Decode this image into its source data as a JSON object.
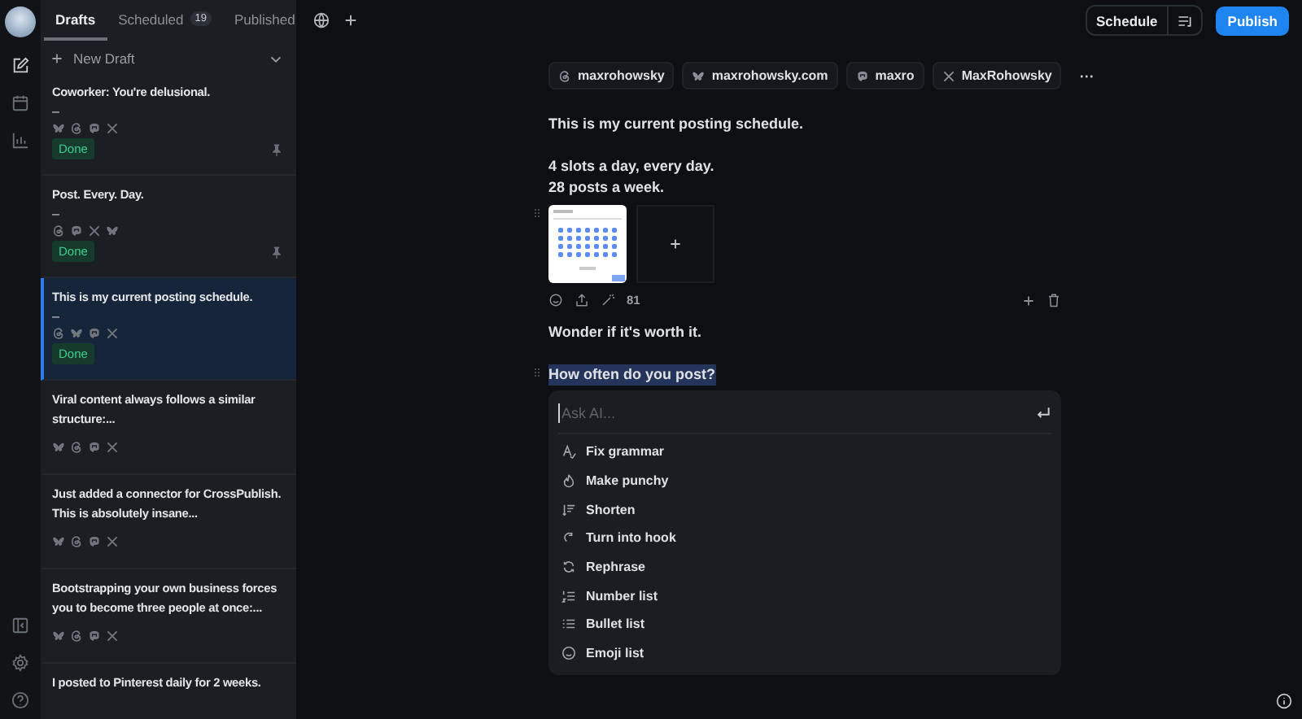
{
  "tabs": [
    {
      "label": "Drafts",
      "selected": true
    },
    {
      "label": "Scheduled",
      "selected": false,
      "count": "19"
    },
    {
      "label": "Published",
      "selected": false
    }
  ],
  "new_draft": {
    "label": "New Draft"
  },
  "drafts": [
    {
      "title": "Coworker: You're delusional.",
      "dash": "–",
      "platforms": [
        {
          "kind": "bluesky"
        },
        {
          "kind": "threads"
        },
        {
          "kind": "mastodon"
        },
        {
          "kind": "x"
        }
      ],
      "status": "Done",
      "pinned": true,
      "selected": false
    },
    {
      "title": "Post. Every. Day.",
      "dash": "–",
      "platforms": [
        {
          "kind": "threads"
        },
        {
          "kind": "mastodon"
        },
        {
          "kind": "x"
        },
        {
          "kind": "bluesky"
        }
      ],
      "status": "Done",
      "pinned": true,
      "selected": false
    },
    {
      "title": "This is my current posting schedule.",
      "dash": "–",
      "platforms": [
        {
          "kind": "threads"
        },
        {
          "kind": "bluesky"
        },
        {
          "kind": "mastodon"
        },
        {
          "kind": "x"
        }
      ],
      "status": "Done",
      "pinned": false,
      "selected": true
    },
    {
      "title": "Viral content always follows a similar structure:...",
      "platforms": [
        {
          "kind": "bluesky"
        },
        {
          "kind": "threads"
        },
        {
          "kind": "mastodon"
        },
        {
          "kind": "x"
        }
      ],
      "pinned": false,
      "selected": false
    },
    {
      "title": "Just added a connector for CrossPublish. This is absolutely insane...",
      "platforms": [
        {
          "kind": "bluesky"
        },
        {
          "kind": "threads"
        },
        {
          "kind": "mastodon"
        },
        {
          "kind": "x"
        }
      ],
      "pinned": false,
      "selected": false
    },
    {
      "title": "Bootstrapping your own business forces you to become three people at once:...",
      "platforms": [
        {
          "kind": "bluesky"
        },
        {
          "kind": "threads"
        },
        {
          "kind": "mastodon"
        },
        {
          "kind": "x"
        }
      ],
      "pinned": false,
      "selected": false
    },
    {
      "title": "I posted to Pinterest daily for 2 weeks.",
      "selected": false
    }
  ],
  "topbar": {
    "schedule": "Schedule",
    "publish": "Publish"
  },
  "accounts": [
    {
      "kind": "threads",
      "handle": "maxrohowsky"
    },
    {
      "kind": "bluesky",
      "handle": "maxrohowsky.com"
    },
    {
      "kind": "mastodon",
      "handle": "maxro"
    },
    {
      "kind": "x",
      "handle": "MaxRohowsky"
    }
  ],
  "more": "···",
  "post_paragraphs": [
    [
      "This is my current posting schedule."
    ],
    [
      "4 slots a day, every day.",
      "28 posts a week."
    ]
  ],
  "char_count": "81",
  "blocks": [
    {
      "text": "Wonder if it's worth it.",
      "highlighted": false
    },
    {
      "text": "How often do you post?",
      "highlighted": true
    }
  ],
  "ai_menu": {
    "placeholder": "Ask AI...",
    "items": [
      {
        "kind": "grammar",
        "label": "Fix grammar"
      },
      {
        "kind": "fire",
        "label": "Make punchy"
      },
      {
        "kind": "shorten",
        "label": "Shorten"
      },
      {
        "kind": "hook",
        "label": "Turn into hook"
      },
      {
        "kind": "rephrase",
        "label": "Rephrase"
      },
      {
        "kind": "numbers",
        "label": "Number list"
      },
      {
        "kind": "bullets",
        "label": "Bullet list"
      },
      {
        "kind": "emoji",
        "label": "Emoji list"
      }
    ]
  }
}
